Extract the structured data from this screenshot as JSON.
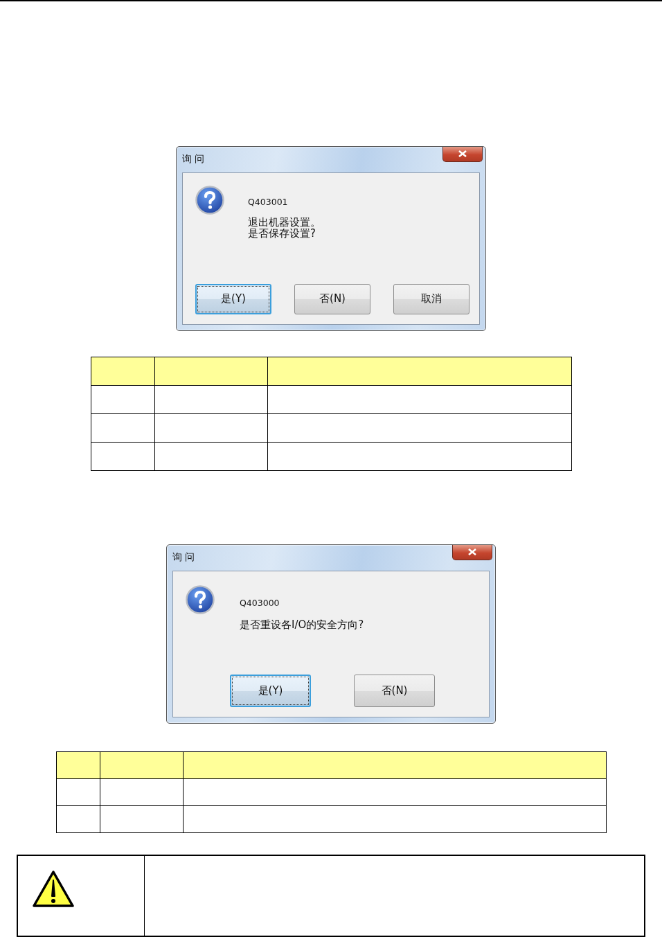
{
  "dialogs": [
    {
      "title": "询 问",
      "code": "Q403001",
      "message_lines": [
        "退出机器设置。",
        "是否保存设置?"
      ],
      "buttons": [
        {
          "label": "是(Y)",
          "selected": true
        },
        {
          "label": "否(N)",
          "selected": false
        },
        {
          "label": "取消",
          "selected": false
        }
      ]
    },
    {
      "title": "询 问",
      "code": "Q403000",
      "message_lines": [
        "是否重设各I/O的安全方向?"
      ],
      "buttons": [
        {
          "label": "是(Y)",
          "selected": true
        },
        {
          "label": "否(N)",
          "selected": false
        }
      ]
    }
  ]
}
